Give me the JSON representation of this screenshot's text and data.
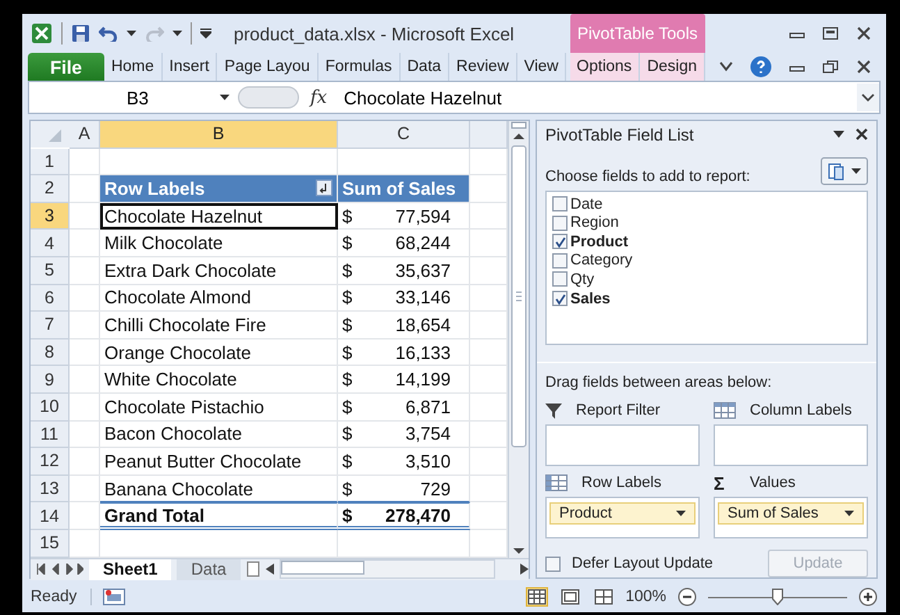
{
  "window": {
    "title": "product_data.xlsx  -  Microsoft Excel",
    "contextual_group": "PivotTable Tools"
  },
  "ribbon_tabs": [
    {
      "label": "File",
      "kind": "file",
      "selected": false
    },
    {
      "label": "Home",
      "kind": "normal",
      "selected": false
    },
    {
      "label": "Insert",
      "kind": "normal",
      "selected": false
    },
    {
      "label": "Page Layou",
      "kind": "normal",
      "selected": false
    },
    {
      "label": "Formulas",
      "kind": "normal",
      "selected": false
    },
    {
      "label": "Data",
      "kind": "normal",
      "selected": false
    },
    {
      "label": "Review",
      "kind": "normal",
      "selected": false
    },
    {
      "label": "View",
      "kind": "normal",
      "selected": false
    },
    {
      "label": "Options",
      "kind": "contextual",
      "selected": false
    },
    {
      "label": "Design",
      "kind": "contextual",
      "selected": false
    }
  ],
  "formula_bar": {
    "name_box": "B3",
    "function_button": "fx",
    "formula": "Chocolate Hazelnut"
  },
  "grid": {
    "columns": [
      {
        "label": "A",
        "selected": false
      },
      {
        "label": "B",
        "selected": true
      },
      {
        "label": "C",
        "selected": false
      }
    ],
    "row_numbers": [
      {
        "label": "1",
        "selected": false
      },
      {
        "label": "2",
        "selected": false
      },
      {
        "label": "3",
        "selected": true
      },
      {
        "label": "4",
        "selected": false
      },
      {
        "label": "5",
        "selected": false
      },
      {
        "label": "6",
        "selected": false
      },
      {
        "label": "7",
        "selected": false
      },
      {
        "label": "8",
        "selected": false
      },
      {
        "label": "9",
        "selected": false
      },
      {
        "label": "10",
        "selected": false
      },
      {
        "label": "11",
        "selected": false
      },
      {
        "label": "12",
        "selected": false
      },
      {
        "label": "13",
        "selected": false
      },
      {
        "label": "14",
        "selected": false
      },
      {
        "label": "15",
        "selected": false
      }
    ],
    "pivot": {
      "header": [
        "Row Labels",
        "Sum of Sales"
      ],
      "rows": [
        {
          "label": "Chocolate Hazelnut",
          "currency": "$",
          "value": "77,594",
          "selected": true
        },
        {
          "label": "Milk Chocolate",
          "currency": "$",
          "value": "68,244",
          "selected": false
        },
        {
          "label": "Extra Dark Chocolate",
          "currency": "$",
          "value": "35,637",
          "selected": false
        },
        {
          "label": "Chocolate Almond",
          "currency": "$",
          "value": "33,146",
          "selected": false
        },
        {
          "label": "Chilli Chocolate Fire",
          "currency": "$",
          "value": "18,654",
          "selected": false
        },
        {
          "label": "Orange Chocolate",
          "currency": "$",
          "value": "16,133",
          "selected": false
        },
        {
          "label": "White Chocolate",
          "currency": "$",
          "value": "14,199",
          "selected": false
        },
        {
          "label": "Chocolate Pistachio",
          "currency": "$",
          "value": "6,871",
          "selected": false
        },
        {
          "label": "Bacon Chocolate",
          "currency": "$",
          "value": "3,754",
          "selected": false
        },
        {
          "label": "Peanut Butter Chocolate",
          "currency": "$",
          "value": "3,510",
          "selected": false
        },
        {
          "label": "Banana Chocolate",
          "currency": "$",
          "value": "729",
          "selected": false
        }
      ],
      "total": {
        "label": "Grand Total",
        "currency": "$",
        "value": "278,470"
      }
    }
  },
  "sheet_tabs": [
    {
      "label": "Sheet1",
      "selected": true
    },
    {
      "label": "Data",
      "selected": false
    }
  ],
  "field_list": {
    "title": "PivotTable Field List",
    "prompt": "Choose fields to add to report:",
    "fields": [
      {
        "label": "Date",
        "checked": false
      },
      {
        "label": "Region",
        "checked": false
      },
      {
        "label": "Product",
        "checked": true
      },
      {
        "label": "Category",
        "checked": false
      },
      {
        "label": "Qty",
        "checked": false
      },
      {
        "label": "Sales",
        "checked": true
      }
    ],
    "areas_prompt": "Drag fields between areas below:",
    "areas": [
      {
        "kind": "filter",
        "label": "Report Filter"
      },
      {
        "kind": "columns",
        "label": "Column Labels"
      },
      {
        "kind": "rows",
        "label": "Row Labels",
        "items": [
          "Product"
        ]
      },
      {
        "kind": "values",
        "label": "Values",
        "symbol": "Σ",
        "items": [
          "Sum of Sales"
        ]
      }
    ],
    "defer": {
      "label": "Defer Layout Update",
      "checked": false
    },
    "update_button": {
      "label": "Update",
      "disabled": true
    }
  },
  "status_bar": {
    "text": "Ready",
    "views": [
      {
        "kind": "normal",
        "selected": true
      },
      {
        "kind": "page_layout",
        "selected": false
      },
      {
        "kind": "page_break",
        "selected": false
      }
    ],
    "zoom": "100%",
    "zoom_slider": {
      "level": 0.5
    }
  }
}
